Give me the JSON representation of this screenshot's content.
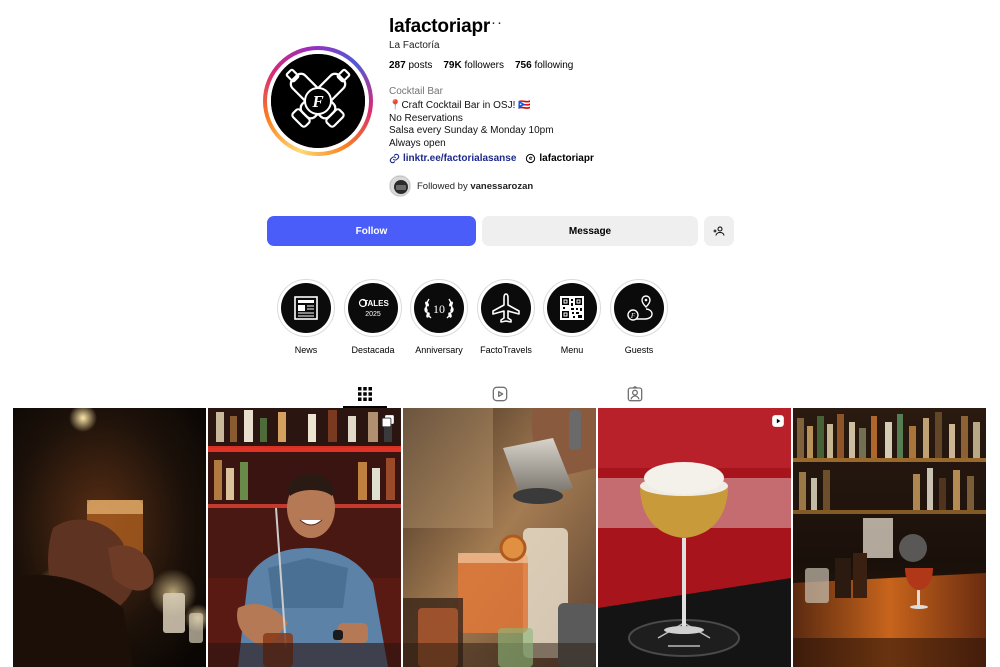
{
  "profile": {
    "username": "lafactoriapr",
    "more_label": "···",
    "full_name": "La Factoría",
    "stats": {
      "posts_count": "287",
      "posts_label": "posts",
      "followers_count": "79K",
      "followers_label": "followers",
      "following_count": "756",
      "following_label": "following"
    },
    "category": "Cocktail Bar",
    "bio_lines": [
      "📍Craft Cocktail Bar in OSJ! 🇵🇷",
      "No Reservations",
      "Salsa every Sunday & Monday 10pm",
      "Always open"
    ],
    "link_text": "linktr.ee/factorialasanse",
    "threads_handle": "lafactoriapr",
    "followed_by_prefix": "Followed by ",
    "followed_by_user": "vanessarozan"
  },
  "actions": {
    "follow_label": "Follow",
    "message_label": "Message",
    "suggest_icon": "person-add-icon"
  },
  "highlights": [
    {
      "label": "News",
      "icon": "newspaper-icon"
    },
    {
      "label": "Destacada",
      "icon": "tales-2025-icon",
      "badge_top": "TALES",
      "badge_bottom": "2025"
    },
    {
      "label": "Anniversary",
      "icon": "laurel-10-icon",
      "badge_number": "10"
    },
    {
      "label": "FactoTravels",
      "icon": "airplane-icon"
    },
    {
      "label": "Menu",
      "icon": "qr-code-icon"
    },
    {
      "label": "Guests",
      "icon": "location-route-icon"
    }
  ],
  "tabs": [
    {
      "name": "posts",
      "icon": "grid-icon",
      "active": true
    },
    {
      "name": "reels",
      "icon": "reels-icon",
      "active": false
    },
    {
      "name": "tagged",
      "icon": "tagged-icon",
      "active": false
    }
  ],
  "posts": [
    {
      "name": "post-candlelit-drink",
      "badge": null
    },
    {
      "name": "post-bartender-smiling",
      "badge": "carousel-icon"
    },
    {
      "name": "post-shaker-pour",
      "badge": null
    },
    {
      "name": "post-coupe-cocktail",
      "badge": "reel-icon"
    },
    {
      "name": "post-bar-counter",
      "badge": null
    }
  ],
  "colors": {
    "follow_button": "#4a5df9",
    "secondary_button": "#efefef",
    "link": "#1d2a8a",
    "muted_text": "#737373"
  }
}
